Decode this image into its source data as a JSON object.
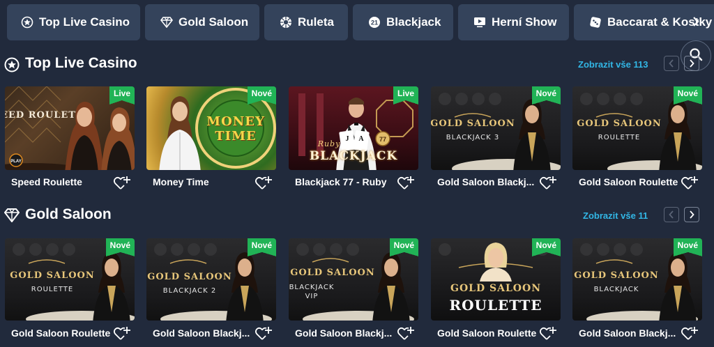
{
  "category_nav": {
    "items": [
      {
        "label": "Top Live Casino",
        "icon": "star-circle-icon"
      },
      {
        "label": "Gold Saloon",
        "icon": "diamond-icon"
      },
      {
        "label": "Ruleta",
        "icon": "roulette-wheel-icon"
      },
      {
        "label": "Blackjack",
        "icon": "blackjack-21-icon"
      },
      {
        "label": "Herní Show",
        "icon": "tv-play-icon"
      },
      {
        "label": "Baccarat & Kostky",
        "icon": "dice-icon"
      }
    ],
    "next_icon": "chevron-right-icon"
  },
  "search": {
    "icon": "search-icon"
  },
  "sections": [
    {
      "title": "Top Live Casino",
      "icon": "star-circle-icon",
      "view_all": "Zobrazit vše 113",
      "games": [
        {
          "name": "Speed Roulette",
          "badge": "Live",
          "logo": "SPEED ROULETTE",
          "sub": ""
        },
        {
          "name": "Money Time",
          "badge": "Nové",
          "logo": "MONEY TIME",
          "sub": ""
        },
        {
          "name": "Blackjack 77 - Ruby",
          "badge": "Live",
          "logo": "BLACKJACK",
          "sub": "Ruby"
        },
        {
          "name": "Gold Saloon Blackj...",
          "badge": "Nové",
          "logo": "GOLD SALOON",
          "sub": "BLACKJACK 3"
        },
        {
          "name": "Gold Saloon Roulette",
          "badge": "Nové",
          "logo": "GOLD SALOON",
          "sub": "ROULETTE"
        }
      ]
    },
    {
      "title": "Gold Saloon",
      "icon": "diamond-icon",
      "view_all": "Zobrazit vše 11",
      "games": [
        {
          "name": "Gold Saloon Roulette",
          "badge": "Nové",
          "logo": "GOLD SALOON",
          "sub": "ROULETTE"
        },
        {
          "name": "Gold Saloon Blackj...",
          "badge": "Nové",
          "logo": "GOLD SALOON",
          "sub": "BLACKJACK 2"
        },
        {
          "name": "Gold Saloon Blackj...",
          "badge": "Nové",
          "logo": "GOLD SALOON",
          "sub": "BLACKJACK VIP"
        },
        {
          "name": "Gold Saloon Roulette",
          "badge": "Nové",
          "logo": "GOLD SALOON",
          "sub": "ROULETTE"
        },
        {
          "name": "Gold Saloon Blackj...",
          "badge": "Nové",
          "logo": "GOLD SALOON",
          "sub": "BLACKJACK"
        }
      ]
    }
  ],
  "colors": {
    "page_bg": "#212a3c",
    "nav_bg": "#34435b",
    "link": "#32b7e6",
    "badge": "#21b356",
    "gold": "#e7c67a"
  }
}
